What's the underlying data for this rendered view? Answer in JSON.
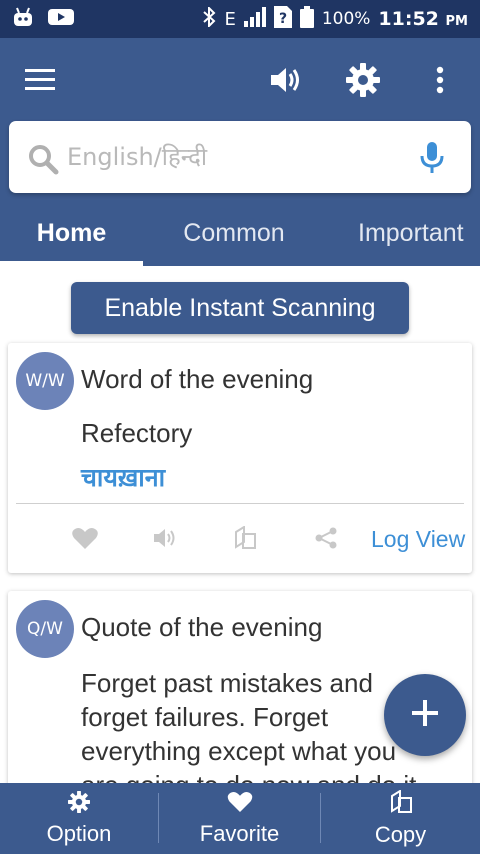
{
  "status_bar": {
    "battery": "100%",
    "time": "11:52",
    "ampm": "PM",
    "network": "E",
    "icons": [
      "android-icon",
      "youtube-icon",
      "bluetooth-icon",
      "signal-icon",
      "sim-unknown-icon",
      "battery-icon"
    ]
  },
  "app_bar": {
    "icons": [
      "menu-icon",
      "volume-icon",
      "settings-icon",
      "more-vert-icon"
    ]
  },
  "search": {
    "placeholder": "English/हिन्दी",
    "value": ""
  },
  "tabs": [
    {
      "label": "Home",
      "active": true
    },
    {
      "label": "Common",
      "active": false
    },
    {
      "label": "Important",
      "active": false
    }
  ],
  "scan_button": {
    "label": "Enable Instant Scanning"
  },
  "word_card": {
    "badge": "W/W",
    "title": "Word of the evening",
    "word": "Refectory",
    "translation": "चायख़ाना",
    "log_view": "Log View"
  },
  "quote_card": {
    "badge": "Q/W",
    "title": "Quote of the evening",
    "lines": [
      "Forget past mistakes and",
      "forget failures. Forget",
      "everything except what you",
      "are going to do now and do it"
    ]
  },
  "bottom_nav": {
    "option": "Option",
    "favorite": "Favorite",
    "copy": "Copy"
  },
  "colors": {
    "primary": "#3c5a8e",
    "status_bar": "#1f3563",
    "accent": "#3d8fd6",
    "badge": "#6c83b8"
  }
}
